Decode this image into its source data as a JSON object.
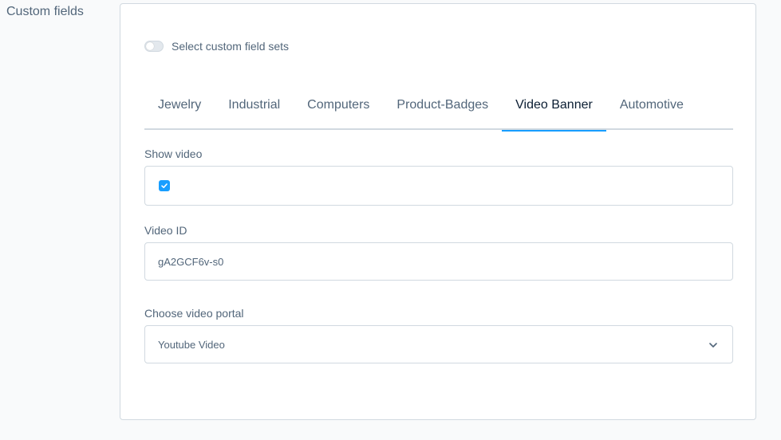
{
  "section_label": "Custom fields",
  "toggle_label": "Select custom field sets",
  "tabs": [
    {
      "label": "Jewelry",
      "active": false
    },
    {
      "label": "Industrial",
      "active": false
    },
    {
      "label": "Computers",
      "active": false
    },
    {
      "label": "Product-Badges",
      "active": false
    },
    {
      "label": "Video Banner",
      "active": true
    },
    {
      "label": "Automotive",
      "active": false
    }
  ],
  "fields": {
    "show_video": {
      "label": "Show video",
      "checked": true
    },
    "video_id": {
      "label": "Video ID",
      "value": "gA2GCF6v-s0"
    },
    "video_portal": {
      "label": "Choose video portal",
      "value": "Youtube Video"
    }
  },
  "colors": {
    "accent": "#189eff",
    "border": "#d1d9e0",
    "text": "#52667a"
  }
}
